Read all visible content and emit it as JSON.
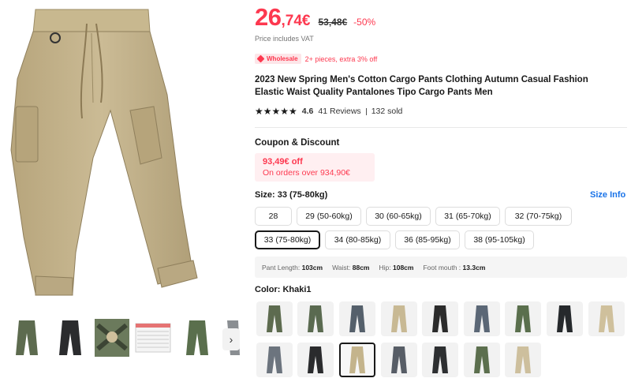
{
  "product": {
    "price_main": "26",
    "price_cents": ",74€",
    "price_original": "53,48€",
    "discount": "-50%",
    "vat_note": "Price includes VAT",
    "wholesale_badge": "Wholesale",
    "wholesale_text": "2+ pieces, extra 3% off",
    "title": "2023 New Spring Men's Cotton Cargo Pants Clothing Autumn Casual Fashion Elastic Waist Quality Pantalones Tipo Cargo Pants Men",
    "stars": "★★★★★",
    "rating": "4.6",
    "reviews": "41 Reviews",
    "sold": "132 sold"
  },
  "coupon": {
    "title": "Coupon & Discount",
    "amount": "93,49€ off",
    "condition": "On orders over 934,90€"
  },
  "size": {
    "label": "Size: 33 (75-80kg)",
    "info_link": "Size Info",
    "options": [
      "28",
      "29 (50-60kg)",
      "30 (60-65kg)",
      "31 (65-70kg)",
      "32 (70-75kg)",
      "33 (75-80kg)",
      "34 (80-85kg)",
      "36 (85-95kg)",
      "38 (95-105kg)"
    ],
    "selected": "33 (75-80kg)"
  },
  "measurements": [
    {
      "label": "Pant Length:",
      "value": "103cm"
    },
    {
      "label": "Waist:",
      "value": "88cm"
    },
    {
      "label": "Hip:",
      "value": "108cm"
    },
    {
      "label": "Foot mouth :",
      "value": "13.3cm"
    }
  ],
  "color": {
    "label": "Color: Khaki1",
    "swatches": [
      {
        "hex": "#5d6b4f"
      },
      {
        "hex": "#5a6a50"
      },
      {
        "hex": "#55606b"
      },
      {
        "hex": "#c8b994"
      },
      {
        "hex": "#2b2b2b"
      },
      {
        "hex": "#5b6776"
      },
      {
        "hex": "#5a6f4d"
      },
      {
        "hex": "#26292c"
      },
      {
        "hex": "#cfc09c"
      },
      {
        "hex": "#6c747e"
      },
      {
        "hex": "#2a2b2d"
      },
      {
        "hex": "#c4b48c"
      },
      {
        "hex": "#575d66"
      },
      {
        "hex": "#2d2f31"
      },
      {
        "hex": "#5c6f4e"
      },
      {
        "hex": "#cdbf9d"
      }
    ],
    "selected_index": 11
  },
  "gallery": {
    "main_color": "#c4b48e",
    "thumbs": [
      {
        "hex": "#5d6b4f"
      },
      {
        "hex": "#2b2c2e"
      },
      {
        "hex": "#5a6a50"
      },
      {
        "hex": "#e8e8e8"
      },
      {
        "hex": "#5a6f4d"
      },
      {
        "hex": "#8a8e92"
      }
    ],
    "next_icon": "chevron-right-icon"
  },
  "colors": {
    "accent": "#fd384f",
    "link": "#1a73e8"
  }
}
